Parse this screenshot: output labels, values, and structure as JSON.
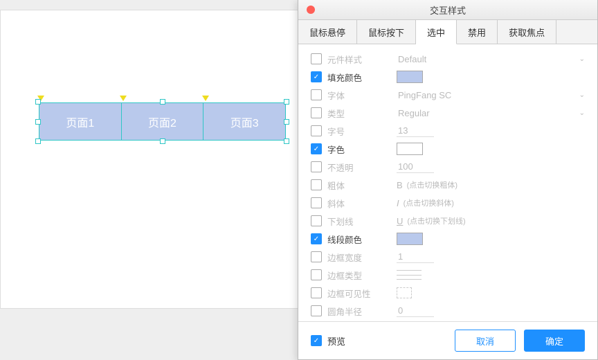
{
  "canvas": {
    "tabs": [
      "页面1",
      "页面2",
      "页面3"
    ]
  },
  "dialog": {
    "title": "交互样式",
    "tabs": [
      "鼠标悬停",
      "鼠标按下",
      "选中",
      "禁用",
      "获取焦点"
    ],
    "active_tab": 2
  },
  "props": [
    {
      "key": "widget_style",
      "label": "元件样式",
      "checked": false,
      "value": "Default"
    },
    {
      "key": "fill_color",
      "label": "填充颜色",
      "checked": true,
      "color": "#b9c9ec"
    },
    {
      "key": "font",
      "label": "字体",
      "checked": false,
      "value": "PingFang SC"
    },
    {
      "key": "type",
      "label": "类型",
      "checked": false,
      "value": "Regular"
    },
    {
      "key": "font_size",
      "label": "字号",
      "checked": false,
      "value": "13"
    },
    {
      "key": "text_color",
      "label": "字色",
      "checked": true,
      "color": "#ffffff"
    },
    {
      "key": "opacity",
      "label": "不透明",
      "checked": false,
      "value": "100"
    },
    {
      "key": "bold",
      "label": "粗体",
      "checked": false,
      "hint": "(点击切换粗体)"
    },
    {
      "key": "italic",
      "label": "斜体",
      "checked": false,
      "hint": "(点击切换斜体)"
    },
    {
      "key": "underline",
      "label": "下划线",
      "checked": false,
      "hint": "(点击切换下划线)"
    },
    {
      "key": "line_color",
      "label": "线段颜色",
      "checked": true,
      "color": "#b9c9ec"
    },
    {
      "key": "border_width",
      "label": "边框宽度",
      "checked": false,
      "value": "1"
    },
    {
      "key": "border_type",
      "label": "边框类型",
      "checked": false
    },
    {
      "key": "border_visibility",
      "label": "边框可见性",
      "checked": false
    },
    {
      "key": "corner_radius",
      "label": "圆角半径",
      "checked": false,
      "value": "0"
    }
  ],
  "footer": {
    "preview": "预览",
    "cancel": "取消",
    "ok": "确定",
    "preview_checked": true
  },
  "colors": {
    "accent": "#1e90ff",
    "selection": "#2ec6c6",
    "fill": "#b9c9ec"
  }
}
